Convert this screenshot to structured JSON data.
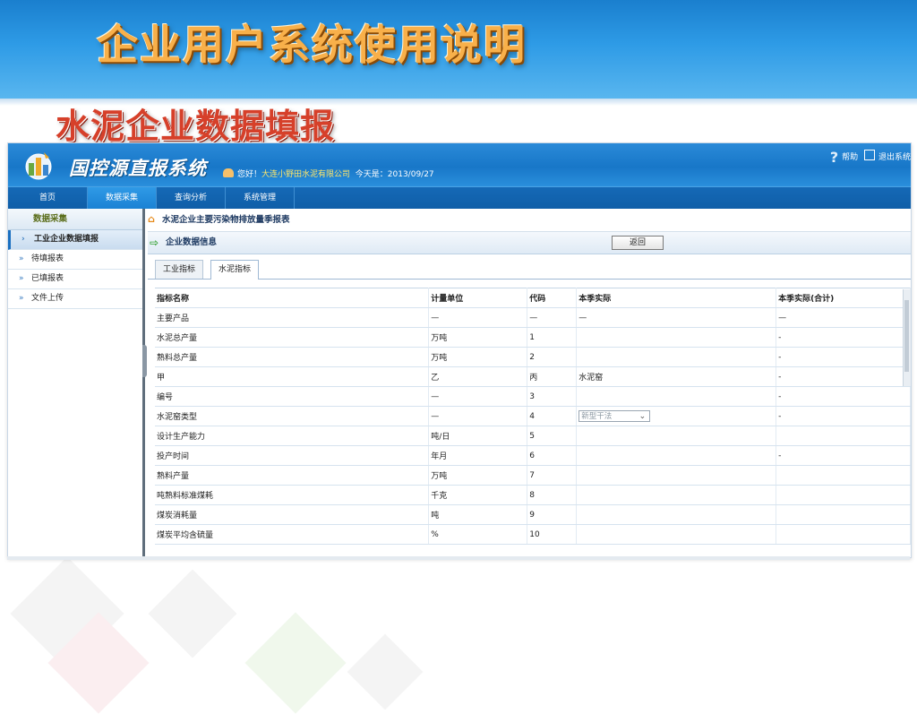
{
  "slide": {
    "title": "企业用户系统使用说明",
    "subtitle": "水泥企业数据填报"
  },
  "app": {
    "logo_text": "国控源直报系统",
    "greeting": "您好！",
    "company": "大连小野田水泥有限公司",
    "today_label": "今天是：",
    "date": "2013/09/27",
    "help_label": "帮助",
    "exit_label": "退出系统"
  },
  "nav": {
    "items": [
      {
        "label": "首页"
      },
      {
        "label": "数据采集"
      },
      {
        "label": "查询分析"
      },
      {
        "label": "系统管理"
      }
    ],
    "active_index": 1
  },
  "sidebar": {
    "title": "数据采集",
    "items": [
      {
        "label": "工业企业数据填报"
      },
      {
        "label": "待填报表"
      },
      {
        "label": "已填报表"
      },
      {
        "label": "文件上传"
      }
    ],
    "active_index": 0
  },
  "content": {
    "breadcrumb": "水泥企业主要污染物排放量季报表",
    "section_title": "企业数据信息",
    "back_button": "返回",
    "tabs": [
      {
        "label": "工业指标"
      },
      {
        "label": "水泥指标"
      }
    ],
    "active_tab": 1,
    "table": {
      "headers": [
        "指标名称",
        "计量单位",
        "代码",
        "本季实际",
        "本季实际(合计)"
      ],
      "rows": [
        [
          "主要产品",
          "—",
          "—",
          "—",
          "—"
        ],
        [
          "水泥总产量",
          "万吨",
          "1",
          "",
          "-"
        ],
        [
          "熟料总产量",
          "万吨",
          "2",
          "",
          "-"
        ],
        [
          "甲",
          "乙",
          "丙",
          "水泥窑",
          "-"
        ],
        [
          "编号",
          "—",
          "3",
          "",
          "-"
        ],
        [
          "水泥窑类型",
          "—",
          "4",
          "新型干法",
          "-"
        ],
        [
          "设计生产能力",
          "吨/日",
          "5",
          "",
          ""
        ],
        [
          "投产时间",
          "年月",
          "6",
          "",
          "-"
        ],
        [
          "熟料产量",
          "万吨",
          "7",
          "",
          ""
        ],
        [
          "吨熟料标准煤耗",
          "千克",
          "8",
          "",
          ""
        ],
        [
          "煤炭消耗量",
          "吨",
          "9",
          "",
          ""
        ],
        [
          "煤炭平均含硫量",
          "%",
          "10",
          "",
          ""
        ]
      ],
      "select_row_index": 5
    }
  },
  "colors": {
    "header_blue": "#1877c8",
    "title_orange": "#f8b04a",
    "subtitle_red": "#d6402a"
  }
}
